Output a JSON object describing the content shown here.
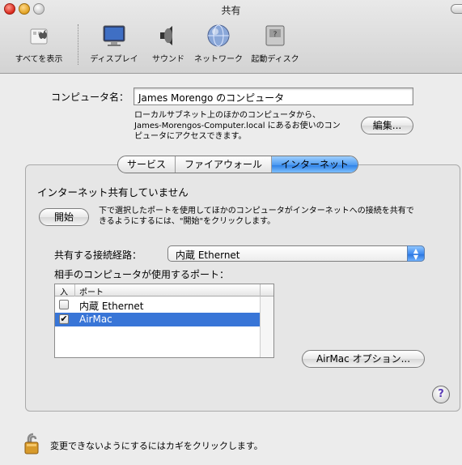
{
  "window": {
    "title": "共有"
  },
  "toolbar": {
    "items": [
      {
        "label": "すべてを表示",
        "icon": "show-all-icon"
      },
      {
        "label": "ディスプレイ",
        "icon": "display-icon"
      },
      {
        "label": "サウンド",
        "icon": "speaker-icon"
      },
      {
        "label": "ネットワーク",
        "icon": "network-globe-icon"
      },
      {
        "label": "起動ディスク",
        "icon": "startup-disk-icon"
      }
    ]
  },
  "computer": {
    "label": "コンピュータ名：",
    "name_value": "James Morengo のコンピュータ",
    "description_line1": "ローカルサブネット上のほかのコンピュータから、",
    "description_line2": "James-Morengos-Computer.local にあるお使いのコン",
    "description_line3": "ピュータにアクセスできます。",
    "edit_button": "編集..."
  },
  "tabs": [
    {
      "label": "サービス",
      "active": false
    },
    {
      "label": "ファイアウォール",
      "active": false
    },
    {
      "label": "インターネット",
      "active": true
    }
  ],
  "internet": {
    "status": "インターネット共有していません",
    "start_button": "開始",
    "instructions_line1": "下で選択したポートを使用してほかのコンピュータがインターネットへの接続を共有で",
    "instructions_line2": "きるようにするには、\"開始\"をクリックします。",
    "share_from_label": "共有する接続経路：",
    "share_from_value": "内蔵 Ethernet",
    "ports_label": "相手のコンピュータが使用するポート：",
    "table": {
      "col_on": "入",
      "col_port": "ポート",
      "rows": [
        {
          "checked": false,
          "port": "内蔵 Ethernet",
          "selected": false
        },
        {
          "checked": true,
          "port": "AirMac",
          "selected": true
        }
      ]
    },
    "airmac_options_button": "AirMac オプション...",
    "help_button": "?"
  },
  "footer": {
    "lock_text": "変更できないようにするにはカギをクリックします。"
  },
  "colors": {
    "selection": "#3875d7",
    "accent_blue": "#3a86ee"
  }
}
